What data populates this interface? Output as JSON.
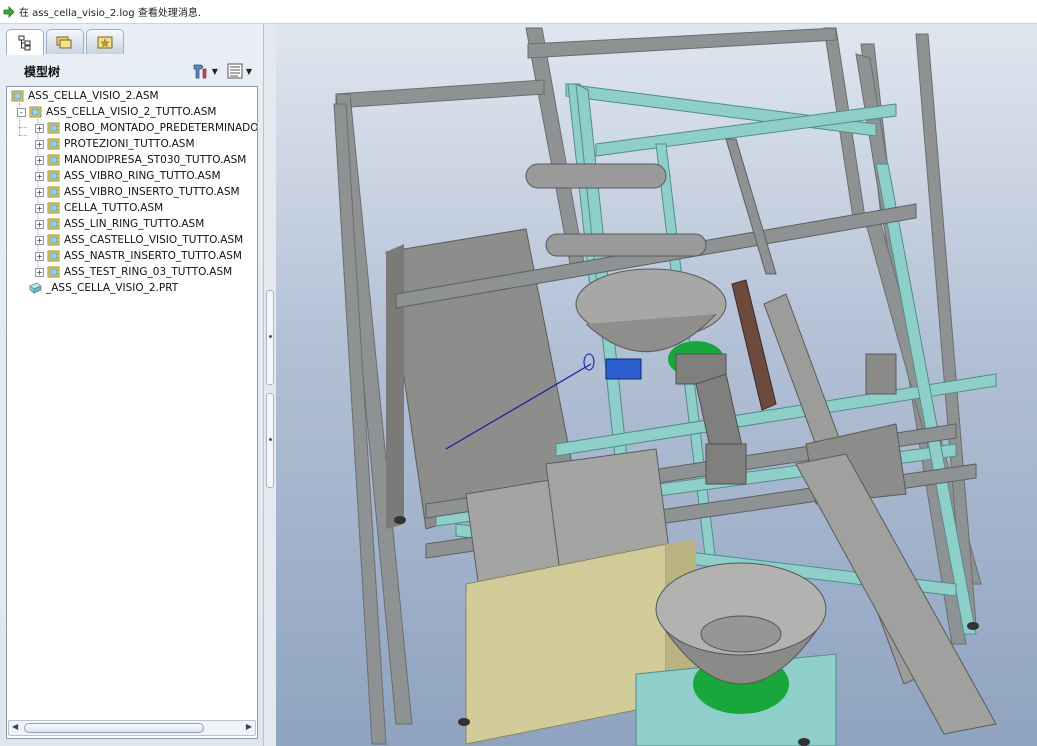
{
  "message_bar": {
    "text": "在 ass_cella_visio_2.log 查看处理消息."
  },
  "left_panel": {
    "tabs": [
      {
        "icon": "model-tree-icon",
        "active": true
      },
      {
        "icon": "folder-browser-icon",
        "active": false
      },
      {
        "icon": "favorites-icon",
        "active": false
      }
    ],
    "tree_title": "模型树",
    "tools": [
      "settings-icon",
      "show-options-icon"
    ],
    "tree": [
      {
        "label": "ASS_CELLA_VISIO_2.ASM",
        "level": 0,
        "expander": "",
        "type": "asm"
      },
      {
        "label": "ASS_CELLA_VISIO_2_TUTTO.ASM",
        "level": 1,
        "expander": "-",
        "type": "asm"
      },
      {
        "label": "ROBO_MONTADO_PREDETERMINADO_",
        "level": 2,
        "expander": "+",
        "type": "asm"
      },
      {
        "label": "PROTEZIONI_TUTTO.ASM",
        "level": 2,
        "expander": "+",
        "type": "asm"
      },
      {
        "label": "MANODIPRESA_ST030_TUTTO.ASM",
        "level": 2,
        "expander": "+",
        "type": "asm"
      },
      {
        "label": "ASS_VIBRO_RING_TUTTO.ASM",
        "level": 2,
        "expander": "+",
        "type": "asm"
      },
      {
        "label": "ASS_VIBRO_INSERTO_TUTTO.ASM",
        "level": 2,
        "expander": "+",
        "type": "asm"
      },
      {
        "label": "CELLA_TUTTO.ASM",
        "level": 2,
        "expander": "+",
        "type": "asm"
      },
      {
        "label": "ASS_LIN_RING_TUTTO.ASM",
        "level": 2,
        "expander": "+",
        "type": "asm"
      },
      {
        "label": "ASS_CASTELLO_VISIO_TUTTO.ASM",
        "level": 2,
        "expander": "+",
        "type": "asm"
      },
      {
        "label": "ASS_NASTR_INSERTO_TUTTO.ASM",
        "level": 2,
        "expander": "+",
        "type": "asm"
      },
      {
        "label": "ASS_TEST_RING_03_TUTTO.ASM",
        "level": 2,
        "expander": "+",
        "type": "asm"
      },
      {
        "label": "_ASS_CELLA_VISIO_2.PRT",
        "level": 1,
        "expander": "",
        "type": "prt"
      }
    ]
  },
  "viewport": {
    "description_icon": "3d-assembly-view",
    "colors": {
      "frame_grey": "#8f9292",
      "frame_teal": "#8fcfca",
      "panel_grey": "#9c9c9a",
      "yellow_base": "#d2cc9a",
      "green_base": "#19a63c",
      "axis_blue": "#1a1aa0"
    }
  }
}
